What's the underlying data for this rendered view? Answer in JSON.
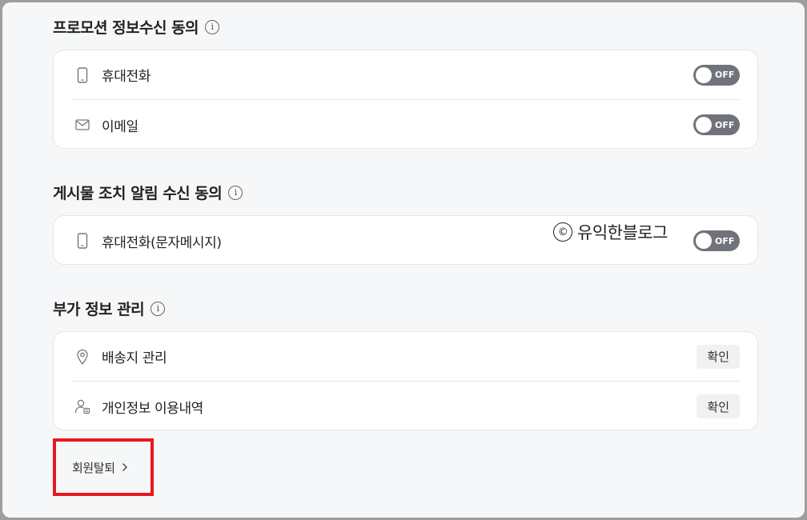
{
  "promotion": {
    "title": "프로모션 정보수신 동의",
    "items": [
      {
        "label": "휴대전화",
        "icon": "phone-icon",
        "toggle": "OFF"
      },
      {
        "label": "이메일",
        "icon": "mail-icon",
        "toggle": "OFF"
      }
    ]
  },
  "post_action": {
    "title": "게시물 조치 알림 수신 동의",
    "items": [
      {
        "label": "휴대전화(문자메시지)",
        "icon": "phone-icon",
        "toggle": "OFF"
      }
    ]
  },
  "extra_info": {
    "title": "부가 정보 관리",
    "items": [
      {
        "label": "배송지 관리",
        "icon": "location-pin-icon",
        "button": "확인"
      },
      {
        "label": "개인정보 이용내역",
        "icon": "user-document-icon",
        "button": "확인"
      }
    ]
  },
  "watermark": {
    "symbol": "©",
    "text": "유익한블로그"
  },
  "withdraw": {
    "label": "회원탈퇴"
  },
  "colors": {
    "toggle_off": "#71737c",
    "highlight_border": "#e8181f",
    "background": "#f6f7f9"
  },
  "info_glyph": "i"
}
